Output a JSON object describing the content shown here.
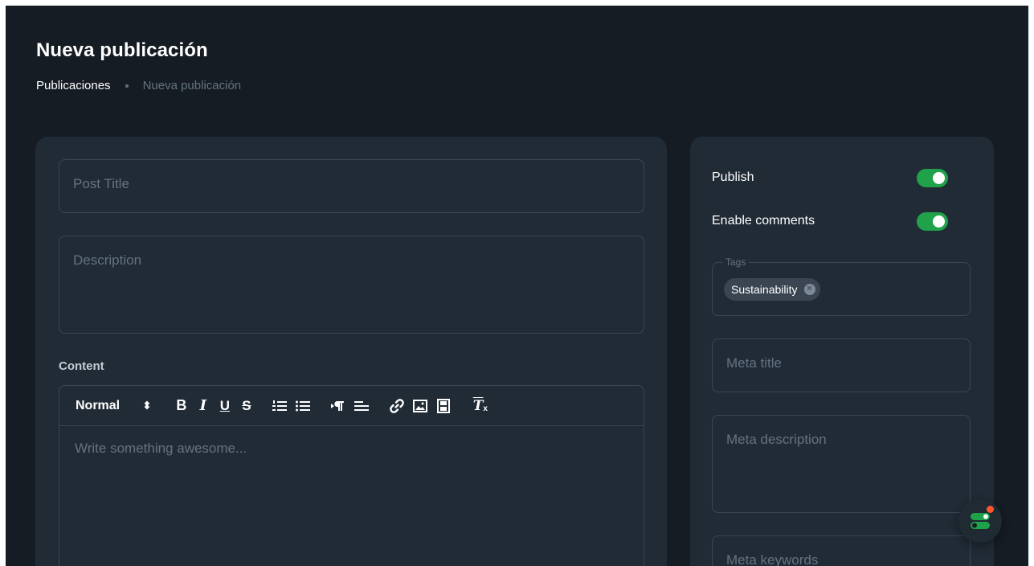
{
  "page": {
    "title": "Nueva publicación"
  },
  "breadcrumb": {
    "parent": "Publicaciones",
    "current": "Nueva publicación"
  },
  "form": {
    "post_title_placeholder": "Post Title",
    "description_placeholder": "Description",
    "content_label": "Content",
    "editor": {
      "style_select": "Normal",
      "placeholder": "Write something awesome...",
      "toolbar_icons": [
        "bold-icon",
        "italic-icon",
        "underline-icon",
        "strikethrough-icon",
        "ordered-list-icon",
        "bullet-list-icon",
        "text-direction-icon",
        "align-icon",
        "link-icon",
        "image-icon",
        "video-icon",
        "clear-format-icon"
      ]
    }
  },
  "sidebar": {
    "publish_label": "Publish",
    "publish_on": true,
    "comments_label": "Enable comments",
    "comments_on": true,
    "tags_legend": "Tags",
    "tags": [
      "Sustainability"
    ],
    "meta_title_placeholder": "Meta title",
    "meta_description_placeholder": "Meta description",
    "meta_keywords_placeholder": "Meta keywords"
  },
  "colors": {
    "background": "#161c24",
    "card": "#212b36",
    "accent": "#1fa24a",
    "placeholder": "#637381",
    "badge": "#ff5630"
  }
}
